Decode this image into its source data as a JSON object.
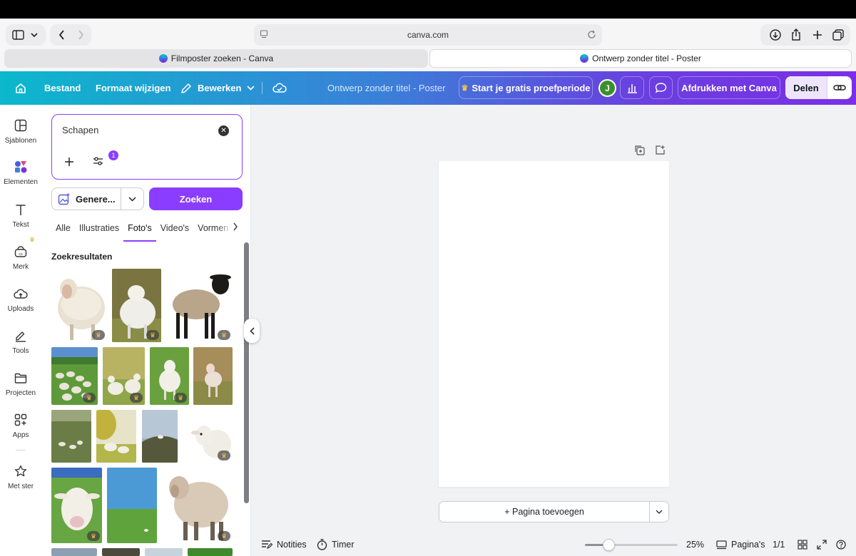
{
  "browser": {
    "url": "canva.com",
    "tabs": [
      {
        "label": "Filmposter zoeken - Canva",
        "active": false
      },
      {
        "label": "Ontwerp zonder titel - Poster",
        "active": true
      }
    ]
  },
  "header": {
    "home_icon": "home-icon",
    "file_label": "Bestand",
    "resize_label": "Formaat wijzigen",
    "edit_label": "Bewerken",
    "doc_title": "Ontwerp zonder titel - Poster",
    "trial_label": "Start je gratis proefperiode",
    "avatar_initial": "J",
    "print_label": "Afdrukken met Canva",
    "share_label": "Delen"
  },
  "rail": {
    "items": [
      {
        "label": "Sjablonen",
        "icon": "templates-icon"
      },
      {
        "label": "Elementen",
        "icon": "elements-icon",
        "active": true
      },
      {
        "label": "Tekst",
        "icon": "text-icon"
      },
      {
        "label": "Merk",
        "icon": "brand-icon"
      },
      {
        "label": "Uploads",
        "icon": "upload-icon"
      },
      {
        "label": "Tools",
        "icon": "tools-icon"
      },
      {
        "label": "Projecten",
        "icon": "folder-icon"
      },
      {
        "label": "Apps",
        "icon": "apps-icon"
      },
      {
        "label": "Met ster",
        "icon": "star-icon"
      }
    ]
  },
  "panel": {
    "search_value": "Schapen",
    "filter_count": "1",
    "generate_label": "Genere...",
    "search_button": "Zoeken",
    "categories": [
      "Alle",
      "Illustraties",
      "Foto's",
      "Video's",
      "Vormen"
    ],
    "selected_category": "Foto's",
    "results_title": "Zoekresultaten"
  },
  "canvas": {
    "add_page_label": "+ Pagina toevoegen"
  },
  "bottombar": {
    "notes_label": "Notities",
    "timer_label": "Timer",
    "zoom_level": 0.25,
    "zoom_text": "25%",
    "pages_label": "Pagina's",
    "page_count": "1/1"
  },
  "colors": {
    "accent": "#8b3dff",
    "header_start": "#0bb8cc",
    "header_end": "#7b2fe6"
  }
}
